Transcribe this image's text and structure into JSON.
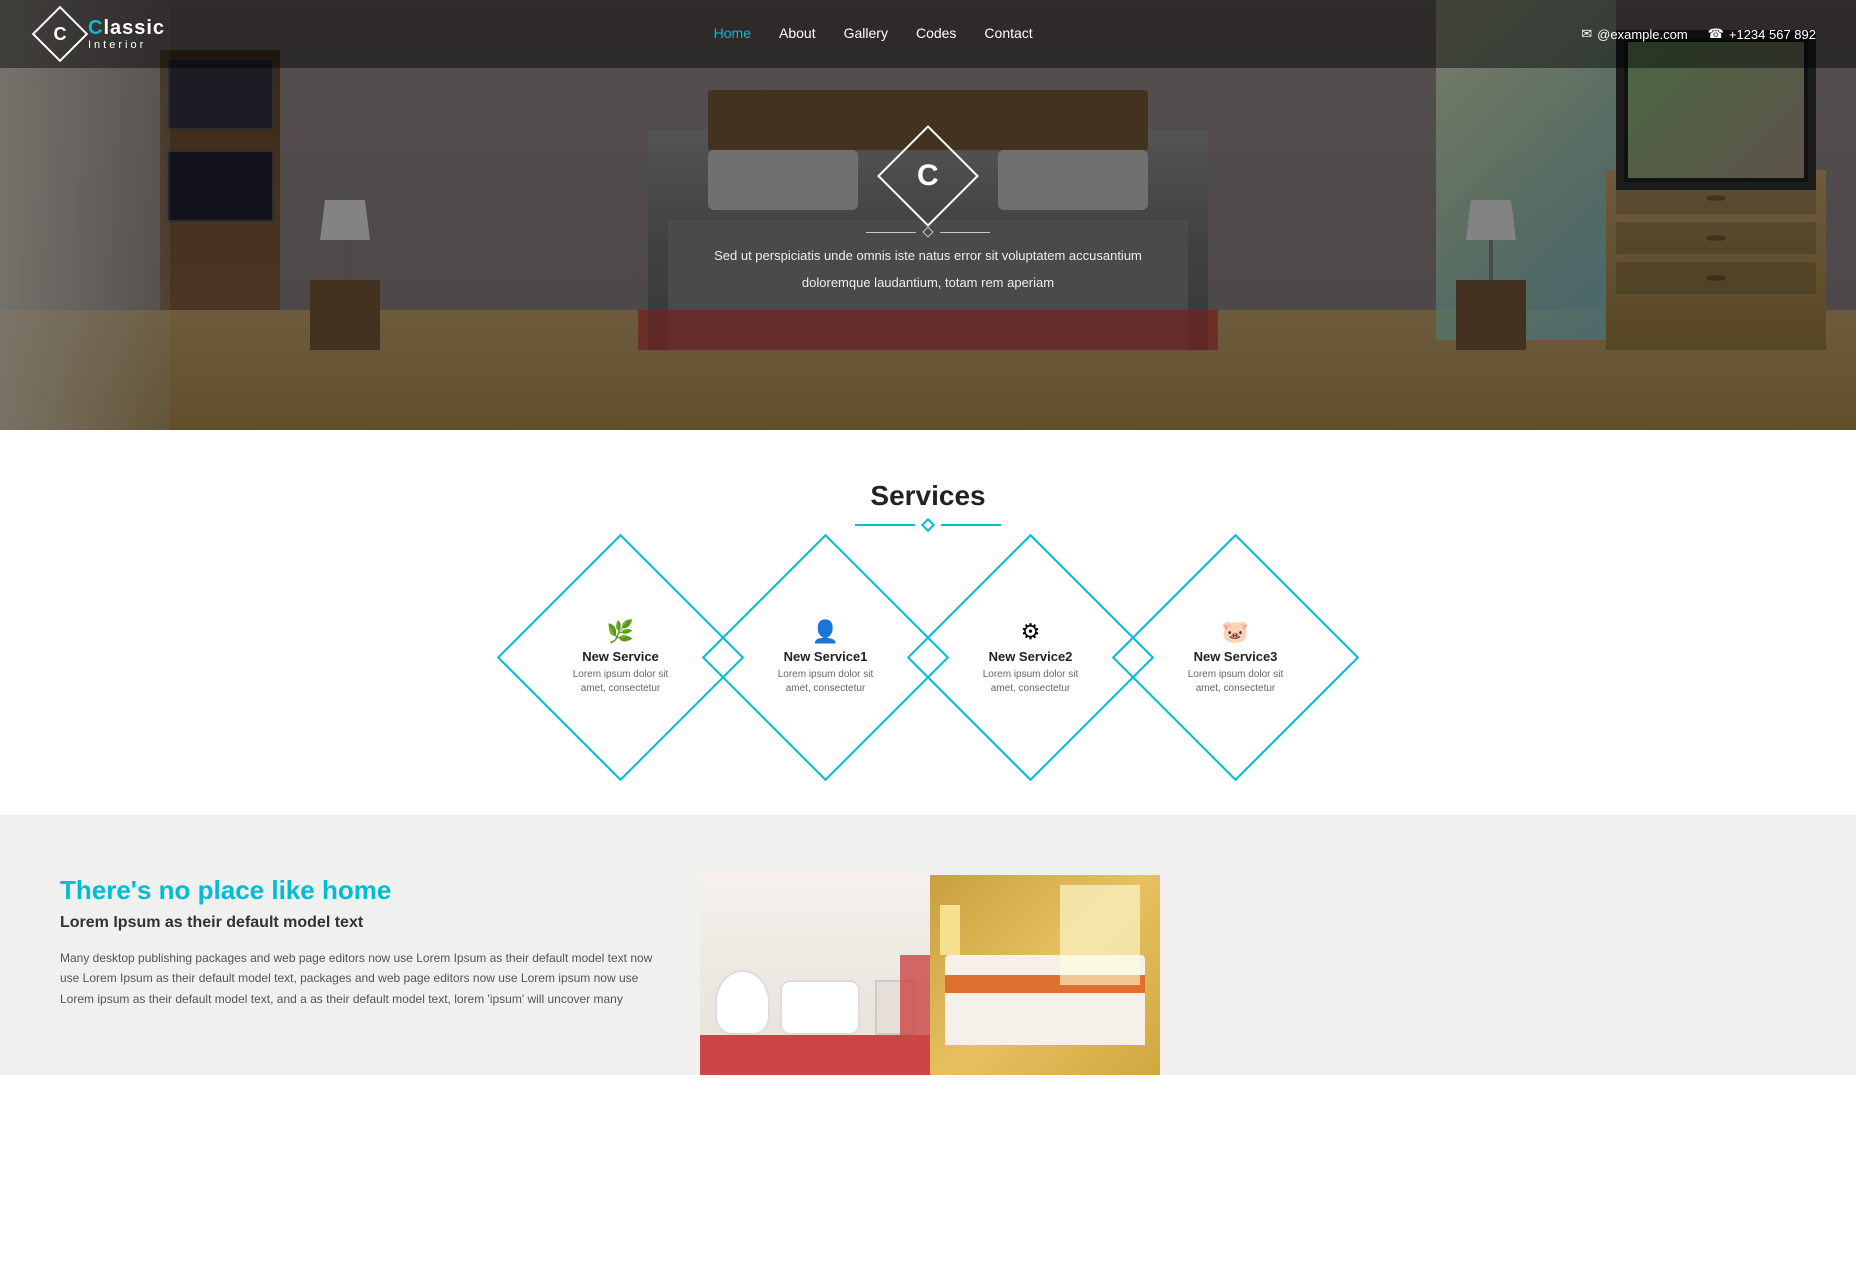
{
  "site": {
    "logo": {
      "letter": "C",
      "brand": "lassic",
      "sub": "Interior"
    }
  },
  "navbar": {
    "links": [
      {
        "label": "Home",
        "active": true
      },
      {
        "label": "About",
        "active": false
      },
      {
        "label": "Gallery",
        "active": false
      },
      {
        "label": "Codes",
        "active": false
      },
      {
        "label": "Contact",
        "active": false
      }
    ],
    "email": "@example.com",
    "phone": "+1234 567 892"
  },
  "hero": {
    "letter": "C",
    "description_line1": "Sed ut perspiciatis unde omnis iste natus error sit voluptatem accusantium",
    "description_line2": "doloremque laudantium, totam rem aperiam"
  },
  "services": {
    "title": "Services",
    "items": [
      {
        "name": "New Service",
        "desc": "Lorem ipsum dolor sit amet, consectetur",
        "icon": "🌿"
      },
      {
        "name": "New Service1",
        "desc": "Lorem ipsum dolor sit amet, consectetur",
        "icon": "👤"
      },
      {
        "name": "New Service2",
        "desc": "Lorem ipsum dolor sit amet, consectetur",
        "icon": "⚙"
      },
      {
        "name": "New Service3",
        "desc": "Lorem ipsum dolor sit amet, consectetur",
        "icon": "🐷"
      }
    ]
  },
  "about": {
    "heading": "There's no place like home",
    "subheading": "Lorem Ipsum as their default model text",
    "body": "Many desktop publishing packages and web page editors now use Lorem Ipsum as their default model text now use Lorem Ipsum as their default model text, packages and web page editors now use Lorem ipsum now use Lorem ipsum as their default model text, and a as their default model text, lorem 'ipsum' will uncover many"
  }
}
